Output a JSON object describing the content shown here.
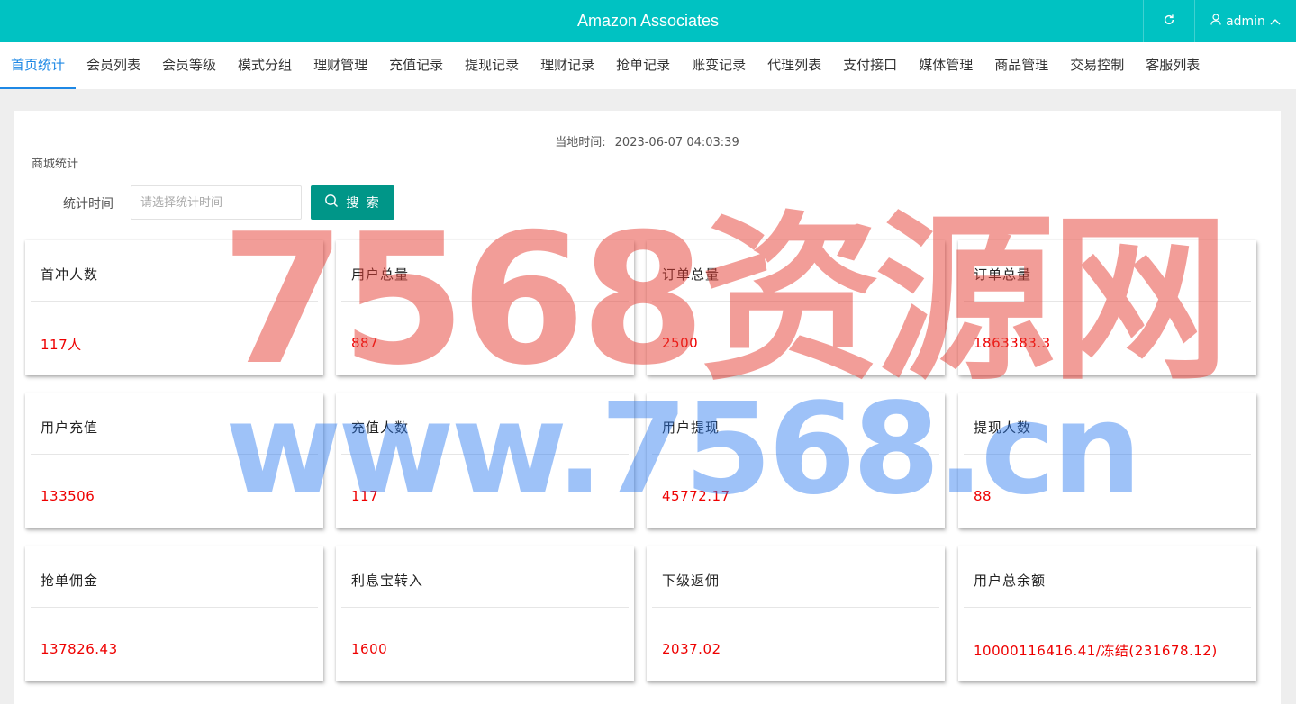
{
  "header": {
    "app_title": "Amazon Associates",
    "user_name": "admin",
    "refresh_icon": "refresh-icon",
    "user_icon": "user-icon",
    "chevron_icon": "chevron-up-icon"
  },
  "nav": {
    "tabs": [
      {
        "label": "首页统计",
        "active": true
      },
      {
        "label": "会员列表"
      },
      {
        "label": "会员等级"
      },
      {
        "label": "模式分组"
      },
      {
        "label": "理财管理"
      },
      {
        "label": "充值记录"
      },
      {
        "label": "提现记录"
      },
      {
        "label": "理财记录"
      },
      {
        "label": "抢单记录"
      },
      {
        "label": "账变记录"
      },
      {
        "label": "代理列表"
      },
      {
        "label": "支付接口"
      },
      {
        "label": "媒体管理"
      },
      {
        "label": "商品管理"
      },
      {
        "label": "交易控制"
      },
      {
        "label": "客服列表"
      }
    ],
    "accent_color": "#1e88e5"
  },
  "main": {
    "local_time_label": "当地时间:",
    "local_time_value": "2023-06-07 04:03:39",
    "section_title": "商城统计",
    "filter": {
      "label": "统计时间",
      "placeholder": "请选择统计时间",
      "search_label": "搜 索"
    },
    "cards": [
      {
        "title": "首冲人数",
        "value": "117人"
      },
      {
        "title": "用户总量",
        "value": "887"
      },
      {
        "title": "订单总量",
        "value": "2500"
      },
      {
        "title": "订单总量",
        "value": "1863383.3"
      },
      {
        "title": "用户充值",
        "value": "133506"
      },
      {
        "title": "充值人数",
        "value": "117"
      },
      {
        "title": "用户提现",
        "value": "45772.17"
      },
      {
        "title": "提现人数",
        "value": "88"
      },
      {
        "title": "抢单佣金",
        "value": "137826.43"
      },
      {
        "title": "利息宝转入",
        "value": "1600"
      },
      {
        "title": "下级返佣",
        "value": "2037.02"
      },
      {
        "title": "用户总余额",
        "value": "10000116416.41/冻结(231678.12)"
      }
    ]
  },
  "watermark": {
    "line1": "7568资源网",
    "line2": "www.7568.cn"
  },
  "colors": {
    "header_bg": "#00c2c2",
    "search_button": "#009688",
    "value_text": "#ee0000"
  }
}
